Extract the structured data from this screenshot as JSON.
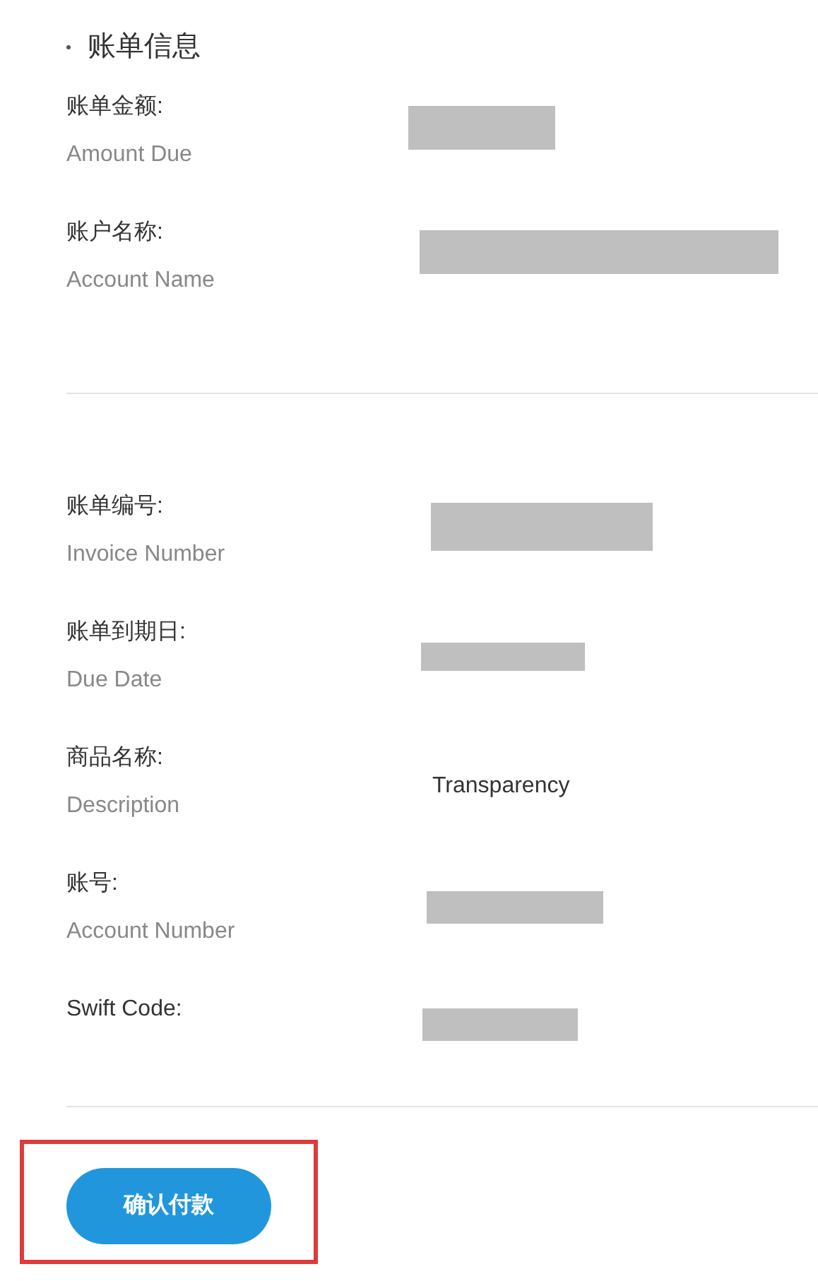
{
  "section_title": "账单信息",
  "sections": [
    {
      "fields": [
        {
          "label": "账单金额:",
          "label_en": "Amount Due",
          "value": {
            "kind": "redacted"
          }
        },
        {
          "label": "账户名称:",
          "label_en": "Account Name",
          "value": {
            "kind": "redacted"
          }
        }
      ]
    },
    {
      "fields": [
        {
          "label": "账单编号:",
          "label_en": "Invoice Number",
          "value": {
            "kind": "redacted"
          }
        },
        {
          "label": "账单到期日:",
          "label_en": "Due Date",
          "value": {
            "kind": "redacted"
          }
        },
        {
          "label": "商品名称:",
          "label_en": "Description",
          "value": {
            "kind": "text",
            "text": "Transparency"
          }
        },
        {
          "label": "账号:",
          "label_en": "Account Number",
          "value": {
            "kind": "redacted"
          }
        },
        {
          "label": "Swift Code:",
          "value": {
            "kind": "redacted"
          }
        }
      ]
    }
  ],
  "button": {
    "label": "确认付款",
    "highlighted": true
  }
}
